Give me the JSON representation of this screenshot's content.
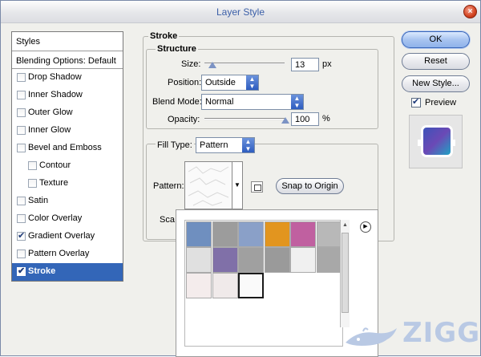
{
  "window": {
    "title": "Layer Style",
    "close_glyph": "×"
  },
  "styles_list": {
    "header": "Styles",
    "blending_options": "Blending Options: Default",
    "items": [
      {
        "label": "Drop Shadow",
        "checked": false,
        "indent": false
      },
      {
        "label": "Inner Shadow",
        "checked": false,
        "indent": false
      },
      {
        "label": "Outer Glow",
        "checked": false,
        "indent": false
      },
      {
        "label": "Inner Glow",
        "checked": false,
        "indent": false
      },
      {
        "label": "Bevel and Emboss",
        "checked": false,
        "indent": false
      },
      {
        "label": "Contour",
        "checked": false,
        "indent": true
      },
      {
        "label": "Texture",
        "checked": false,
        "indent": true
      },
      {
        "label": "Satin",
        "checked": false,
        "indent": false
      },
      {
        "label": "Color Overlay",
        "checked": false,
        "indent": false
      },
      {
        "label": "Gradient Overlay",
        "checked": true,
        "indent": false
      },
      {
        "label": "Pattern Overlay",
        "checked": false,
        "indent": false
      },
      {
        "label": "Stroke",
        "checked": true,
        "indent": false,
        "selected": true
      }
    ]
  },
  "stroke": {
    "section_title": "Stroke",
    "structure_title": "Structure",
    "size_label": "Size:",
    "size_value": "13",
    "size_unit": "px",
    "size_slider_fraction": 0.05,
    "position_label": "Position:",
    "position_value": "Outside",
    "blend_mode_label": "Blend Mode:",
    "blend_mode_value": "Normal",
    "opacity_label": "Opacity:",
    "opacity_value": "100",
    "opacity_unit": "%",
    "opacity_slider_fraction": 1.0,
    "fill_type_label": "Fill Type:",
    "fill_type_value": "Pattern",
    "pattern_label": "Pattern:",
    "snap_button": "Snap to Origin",
    "scale_label_partial": "Sca"
  },
  "buttons": {
    "ok": "OK",
    "reset": "Reset",
    "new_style": "New Style...",
    "preview_label": "Preview",
    "preview_checked": true
  },
  "preview_colors": {
    "start": "#3d53b8",
    "mid": "#6b49b6",
    "end": "#1fa2c4"
  },
  "pattern_picker": {
    "tiles": [
      {
        "name": "bubbles",
        "bg": "#6f8fbf"
      },
      {
        "name": "wrinkles",
        "bg": "#9c9c9c"
      },
      {
        "name": "woven",
        "bg": "#8aa0c8"
      },
      {
        "name": "tie-dye",
        "bg": "#e2951f"
      },
      {
        "name": "rainbow-scales",
        "bg": "#c060a0"
      },
      {
        "name": "stones",
        "bg": "#b8b8b8"
      },
      {
        "name": "checkerboard",
        "bg": "#e0e0e0"
      },
      {
        "name": "metal-landscape",
        "bg": "#8070a8"
      },
      {
        "name": "clouds",
        "bg": "#a0a0a0"
      },
      {
        "name": "speckle",
        "bg": "#9a9a9a"
      },
      {
        "name": "dashes",
        "bg": "#f0f0f0"
      },
      {
        "name": "gray-stone",
        "bg": "#a8a8a8"
      },
      {
        "name": "butterfly-a",
        "bg": "#f4ecec"
      },
      {
        "name": "butterfly-b",
        "bg": "#f0eaea"
      },
      {
        "name": "white-crumple",
        "bg": "#fafafa",
        "selected": true
      }
    ],
    "menu_icon": "menu-arrow-icon",
    "scroll_up_glyph": "▲"
  },
  "watermark": {
    "text": "ZIGG",
    "color": "#b9c9e4"
  }
}
